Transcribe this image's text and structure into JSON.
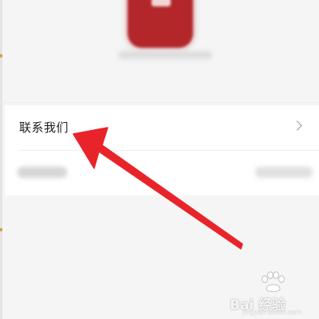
{
  "header": {
    "logo_icon": "app-logo-icon",
    "logo_color": "#b3262a"
  },
  "list": {
    "items": [
      {
        "label": "联系我们",
        "icon": "chevron-right-icon"
      }
    ]
  },
  "annotation": {
    "arrow_color": "#e8242a",
    "arrow_icon": "red-arrow-icon"
  },
  "watermark": {
    "text": "Bai 经验",
    "url": "jingyan.baidu.com",
    "icon": "baidu-paw-icon"
  }
}
